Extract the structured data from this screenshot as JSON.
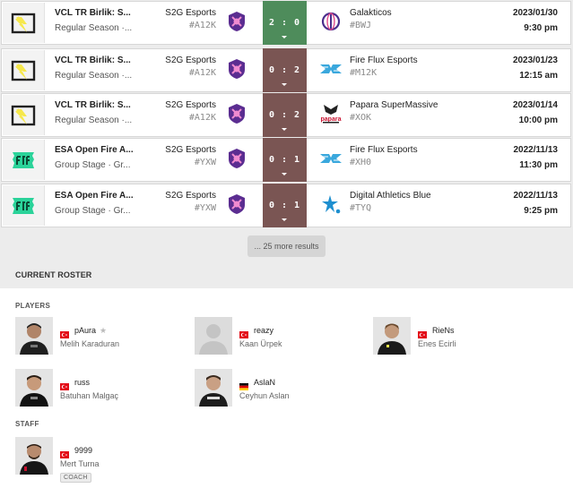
{
  "matches": [
    {
      "event_name": "VCL TR Birlik: S...",
      "event_stage": "Regular Season ·...",
      "event_icon": "vcl-tr-birlik-logo-icon",
      "team1": "S2G Esports",
      "team1_tag": "#A12K",
      "team1_icon": "s2g-esports-logo-icon",
      "score": "2 : 0",
      "result": "win",
      "team2": "Galakticos",
      "team2_tag": "#BWJ",
      "team2_icon": "galakticos-logo-icon",
      "date": "2023/01/30",
      "time": "9:30 pm"
    },
    {
      "event_name": "VCL TR Birlik: S...",
      "event_stage": "Regular Season ·...",
      "event_icon": "vcl-tr-birlik-logo-icon",
      "team1": "S2G Esports",
      "team1_tag": "#A12K",
      "team1_icon": "s2g-esports-logo-icon",
      "score": "0 : 2",
      "result": "loss",
      "team2": "Fire Flux Esports",
      "team2_tag": "#M12K",
      "team2_icon": "fire-flux-logo-icon",
      "date": "2023/01/23",
      "time": "12:15 am"
    },
    {
      "event_name": "VCL TR Birlik: S...",
      "event_stage": "Regular Season ·...",
      "event_icon": "vcl-tr-birlik-logo-icon",
      "team1": "S2G Esports",
      "team1_tag": "#A12K",
      "team1_icon": "s2g-esports-logo-icon",
      "score": "0 : 2",
      "result": "loss",
      "team2": "Papara SuperMassive",
      "team2_tag": "#XOK",
      "team2_icon": "papara-supermassive-logo-icon",
      "team2_logo_text": "papara",
      "date": "2023/01/14",
      "time": "10:00 pm"
    },
    {
      "event_name": "ESA Open Fire A...",
      "event_stage": "Group Stage · Gr...",
      "event_icon": "esa-open-fire-logo-icon",
      "team1": "S2G Esports",
      "team1_tag": "#YXW",
      "team1_icon": "s2g-esports-logo-icon",
      "score": "0 : 1",
      "result": "loss",
      "team2": "Fire Flux Esports",
      "team2_tag": "#XH0",
      "team2_icon": "fire-flux-logo-icon",
      "date": "2022/11/13",
      "time": "11:30 pm"
    },
    {
      "event_name": "ESA Open Fire A...",
      "event_stage": "Group Stage · Gr...",
      "event_icon": "esa-open-fire-logo-icon",
      "team1": "S2G Esports",
      "team1_tag": "#YXW",
      "team1_icon": "s2g-esports-logo-icon",
      "score": "0 : 1",
      "result": "loss",
      "team2": "Digital Athletics Blue",
      "team2_tag": "#TYQ",
      "team2_icon": "digital-athletics-logo-icon",
      "date": "2022/11/13",
      "time": "9:25 pm"
    }
  ],
  "more_results_label": "... 25 more results",
  "roster": {
    "title": "CURRENT ROSTER",
    "players_label": "PLAYERS",
    "staff_label": "STAFF",
    "players": [
      {
        "nick": "pAura",
        "name": "Melih Karaduran",
        "flag": "turkey-flag-icon",
        "captain": true,
        "photo": "player-photo"
      },
      {
        "nick": "reazy",
        "name": "Kaan Ürpek",
        "flag": "turkey-flag-icon",
        "captain": false,
        "photo": "placeholder-avatar"
      },
      {
        "nick": "RieNs",
        "name": "Enes Ecirli",
        "flag": "turkey-flag-icon",
        "captain": false,
        "photo": "player-photo"
      },
      {
        "nick": "russ",
        "name": "Batuhan Malgaç",
        "flag": "turkey-flag-icon",
        "captain": false,
        "photo": "player-photo"
      },
      {
        "nick": "AslaN",
        "name": "Ceyhun Aslan",
        "flag": "germany-flag-icon",
        "captain": false,
        "photo": "player-photo"
      }
    ],
    "staff": [
      {
        "nick": "9999",
        "name": "Mert Turna",
        "flag": "turkey-flag-icon",
        "role": "COACH",
        "photo": "player-photo"
      }
    ]
  },
  "colors": {
    "win": "#4e8c5b",
    "loss": "#7a5553",
    "s2g_purple": "#5b2d91",
    "fire_flux_blue": "#3aa8dd",
    "galakticos_purple": "#4a2e8c"
  }
}
